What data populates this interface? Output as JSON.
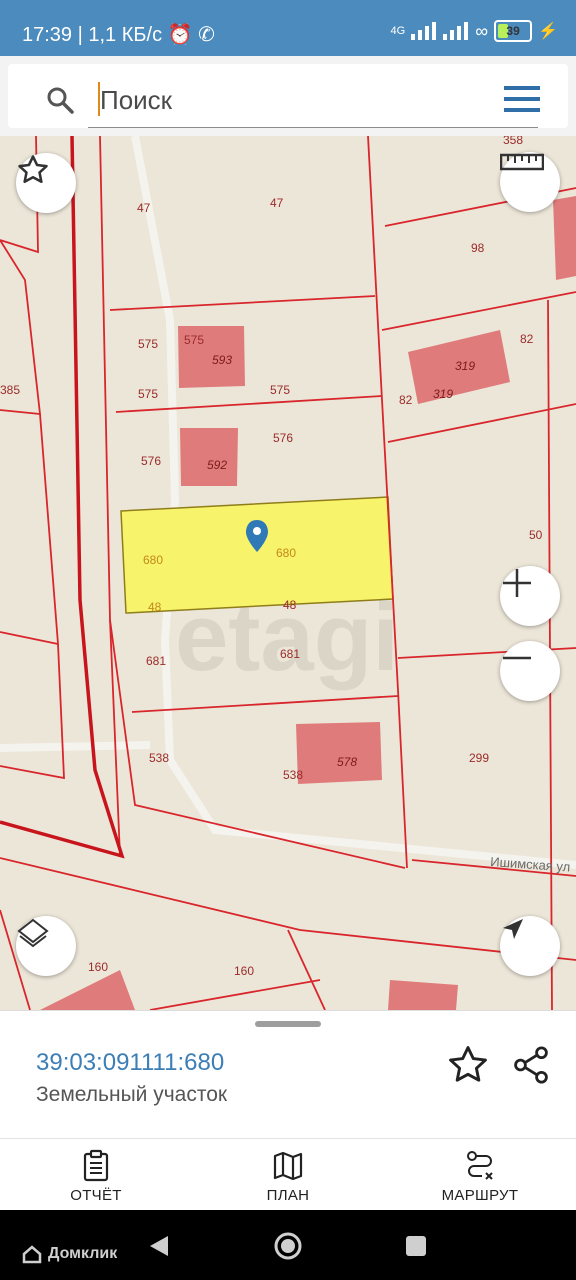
{
  "status_bar": {
    "time": "17:39",
    "network_speed": "| 1,1 КБ/с",
    "battery_level": "39",
    "network_type": "4G"
  },
  "search": {
    "placeholder": "Поиск"
  },
  "map": {
    "watermark": "etagi",
    "street_label": "Ишимская ул",
    "selected_parcel_number": "680",
    "parcel_labels": [
      "358",
      "47",
      "47",
      "98",
      "575",
      "575",
      "593",
      "575",
      "575",
      "319",
      "82",
      "82",
      "319",
      "576",
      "576",
      "592",
      "50",
      "680",
      "680",
      "48",
      "48",
      "681",
      "681",
      "538",
      "578",
      "538",
      "299",
      "160",
      "160",
      "385"
    ]
  },
  "map_controls": {
    "favorite": "star-icon",
    "ruler": "ruler-icon",
    "zoom_in": "plus-icon",
    "zoom_out": "minus-icon",
    "layers": "layers-icon",
    "location": "navigation-arrow-icon"
  },
  "details": {
    "cadastral_number": "39:03:091111:680",
    "object_type": "Земельный участок"
  },
  "bottom_nav": {
    "report": "ОТЧЁТ",
    "plan": "ПЛАН",
    "route": "МАРШРУТ"
  },
  "system_nav": {
    "brand": "Домклик"
  },
  "colors": {
    "status_bar": "#4b8bbd",
    "accent": "#3c7eb6",
    "selected_parcel": "#f7f36a",
    "building": "#e07b7b",
    "boundary": "#d9262c"
  }
}
